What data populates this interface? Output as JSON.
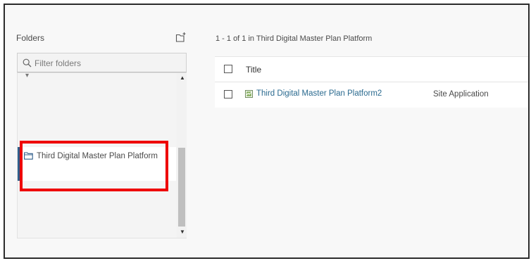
{
  "folders_panel": {
    "title": "Folders",
    "filter_placeholder": "Filter folders",
    "selected_folder": "Third Digital Master Plan Platform"
  },
  "content": {
    "results_count": "1 - 1 of 1 in Third Digital Master Plan Platform",
    "columns": {
      "title": "Title"
    },
    "rows": [
      {
        "title": "Third Digital Master Plan Platform2",
        "type": "Site Application"
      }
    ]
  },
  "icons": {
    "new_folder": "new-folder-icon",
    "search": "search-icon",
    "folder": "folder-icon",
    "item_thumb": "site-app-icon"
  },
  "colors": {
    "highlight": "#ee0000",
    "link": "#2a6a8f",
    "selected_accent": "#2f5d8a"
  }
}
